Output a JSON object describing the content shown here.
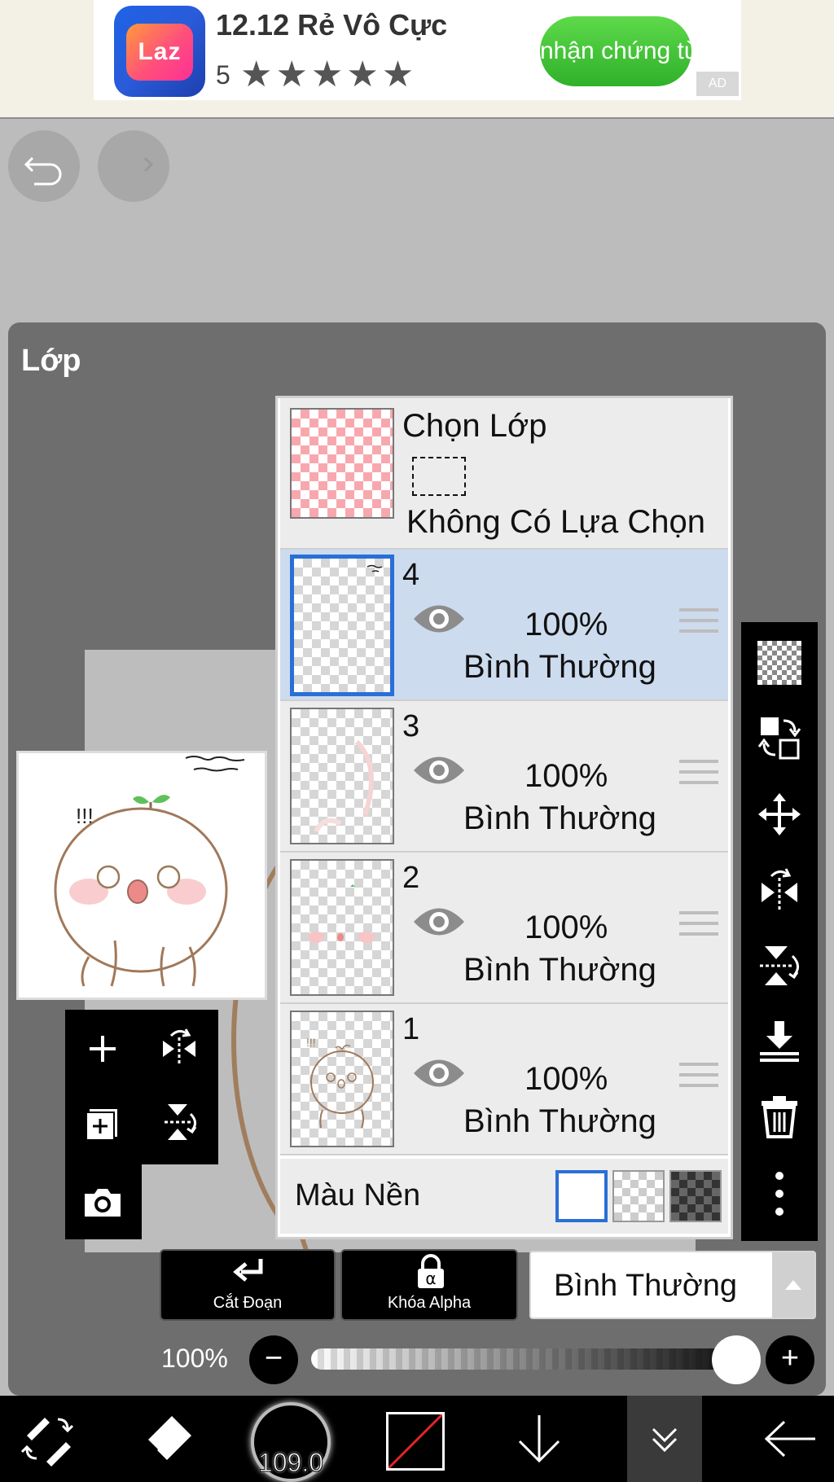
{
  "ad": {
    "logo_text": "Laz",
    "title": "12.12 Rẻ Vô Cực",
    "rating": "5",
    "stars": "★★★★★",
    "cta": "nhận chứng từ",
    "badge": "AD"
  },
  "panel": {
    "title": "Lớp"
  },
  "selection_row": {
    "title": "Chọn Lớp",
    "status": "Không Có Lựa Chọn"
  },
  "layers": [
    {
      "number": "4",
      "opacity": "100%",
      "mode": "Bình Thường",
      "visible": true,
      "selected": true
    },
    {
      "number": "3",
      "opacity": "100%",
      "mode": "Bình Thường",
      "visible": true,
      "selected": false
    },
    {
      "number": "2",
      "opacity": "100%",
      "mode": "Bình Thường",
      "visible": true,
      "selected": false
    },
    {
      "number": "1",
      "opacity": "100%",
      "mode": "Bình Thường",
      "visible": true,
      "selected": false
    }
  ],
  "background": {
    "label": "Màu Nền",
    "selected": "white"
  },
  "actions": {
    "clip": "Cắt Đoạn",
    "alpha_lock": "Khóa Alpha",
    "alpha_symbol": "α",
    "blend_mode": "Bình Thường"
  },
  "opacity": {
    "value": "100%",
    "level": 1.0
  },
  "toolbar": {
    "brush_size": "109.0"
  },
  "colors": {
    "accent": "#2a6fd6",
    "selected_row": "#cddbef",
    "cta_green": "#3cc032"
  }
}
